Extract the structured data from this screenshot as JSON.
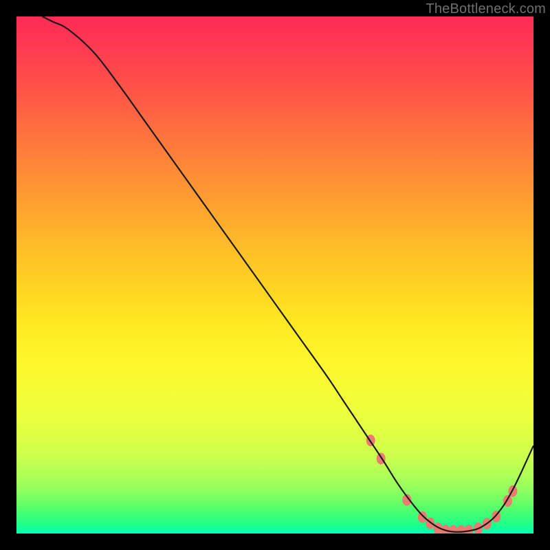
{
  "watermark": "TheBottleneck.com",
  "accent": {
    "dot_fill": "#eb7a72",
    "curve_stroke": "#1a1a1a"
  },
  "chart_data": {
    "type": "line",
    "title": "",
    "xlabel": "",
    "ylabel": "",
    "xlim": [
      0,
      100
    ],
    "ylim": [
      0,
      100
    ],
    "grid": false,
    "series": [
      {
        "name": "curve",
        "x": [
          5,
          7,
          10,
          15,
          20,
          25,
          30,
          35,
          40,
          45,
          50,
          55,
          60,
          63,
          65,
          68,
          71,
          73.5,
          76,
          78.5,
          81,
          83,
          85,
          87.5,
          90,
          93,
          96,
          100
        ],
        "y": [
          100,
          99,
          97.5,
          93,
          86.5,
          79.5,
          72.5,
          65.5,
          58.5,
          51.5,
          44.5,
          37.5,
          30.5,
          26,
          23,
          18.5,
          14,
          10,
          6.5,
          3.5,
          1.5,
          0.6,
          0.3,
          0.5,
          1.3,
          3.8,
          8.5,
          17
        ]
      }
    ],
    "dots": [
      {
        "x": 68.5,
        "y": 18
      },
      {
        "x": 70.5,
        "y": 14.5
      },
      {
        "x": 75.5,
        "y": 6.5
      },
      {
        "x": 78.5,
        "y": 3.2
      },
      {
        "x": 80.0,
        "y": 2.0
      },
      {
        "x": 81.5,
        "y": 1.0
      },
      {
        "x": 83.0,
        "y": 0.6
      },
      {
        "x": 84.5,
        "y": 0.5
      },
      {
        "x": 86.0,
        "y": 0.5
      },
      {
        "x": 87.5,
        "y": 0.6
      },
      {
        "x": 89.3,
        "y": 1.0
      },
      {
        "x": 91.0,
        "y": 1.9
      },
      {
        "x": 92.8,
        "y": 3.3
      },
      {
        "x": 95.0,
        "y": 6.3
      },
      {
        "x": 96.0,
        "y": 8.2
      }
    ]
  }
}
